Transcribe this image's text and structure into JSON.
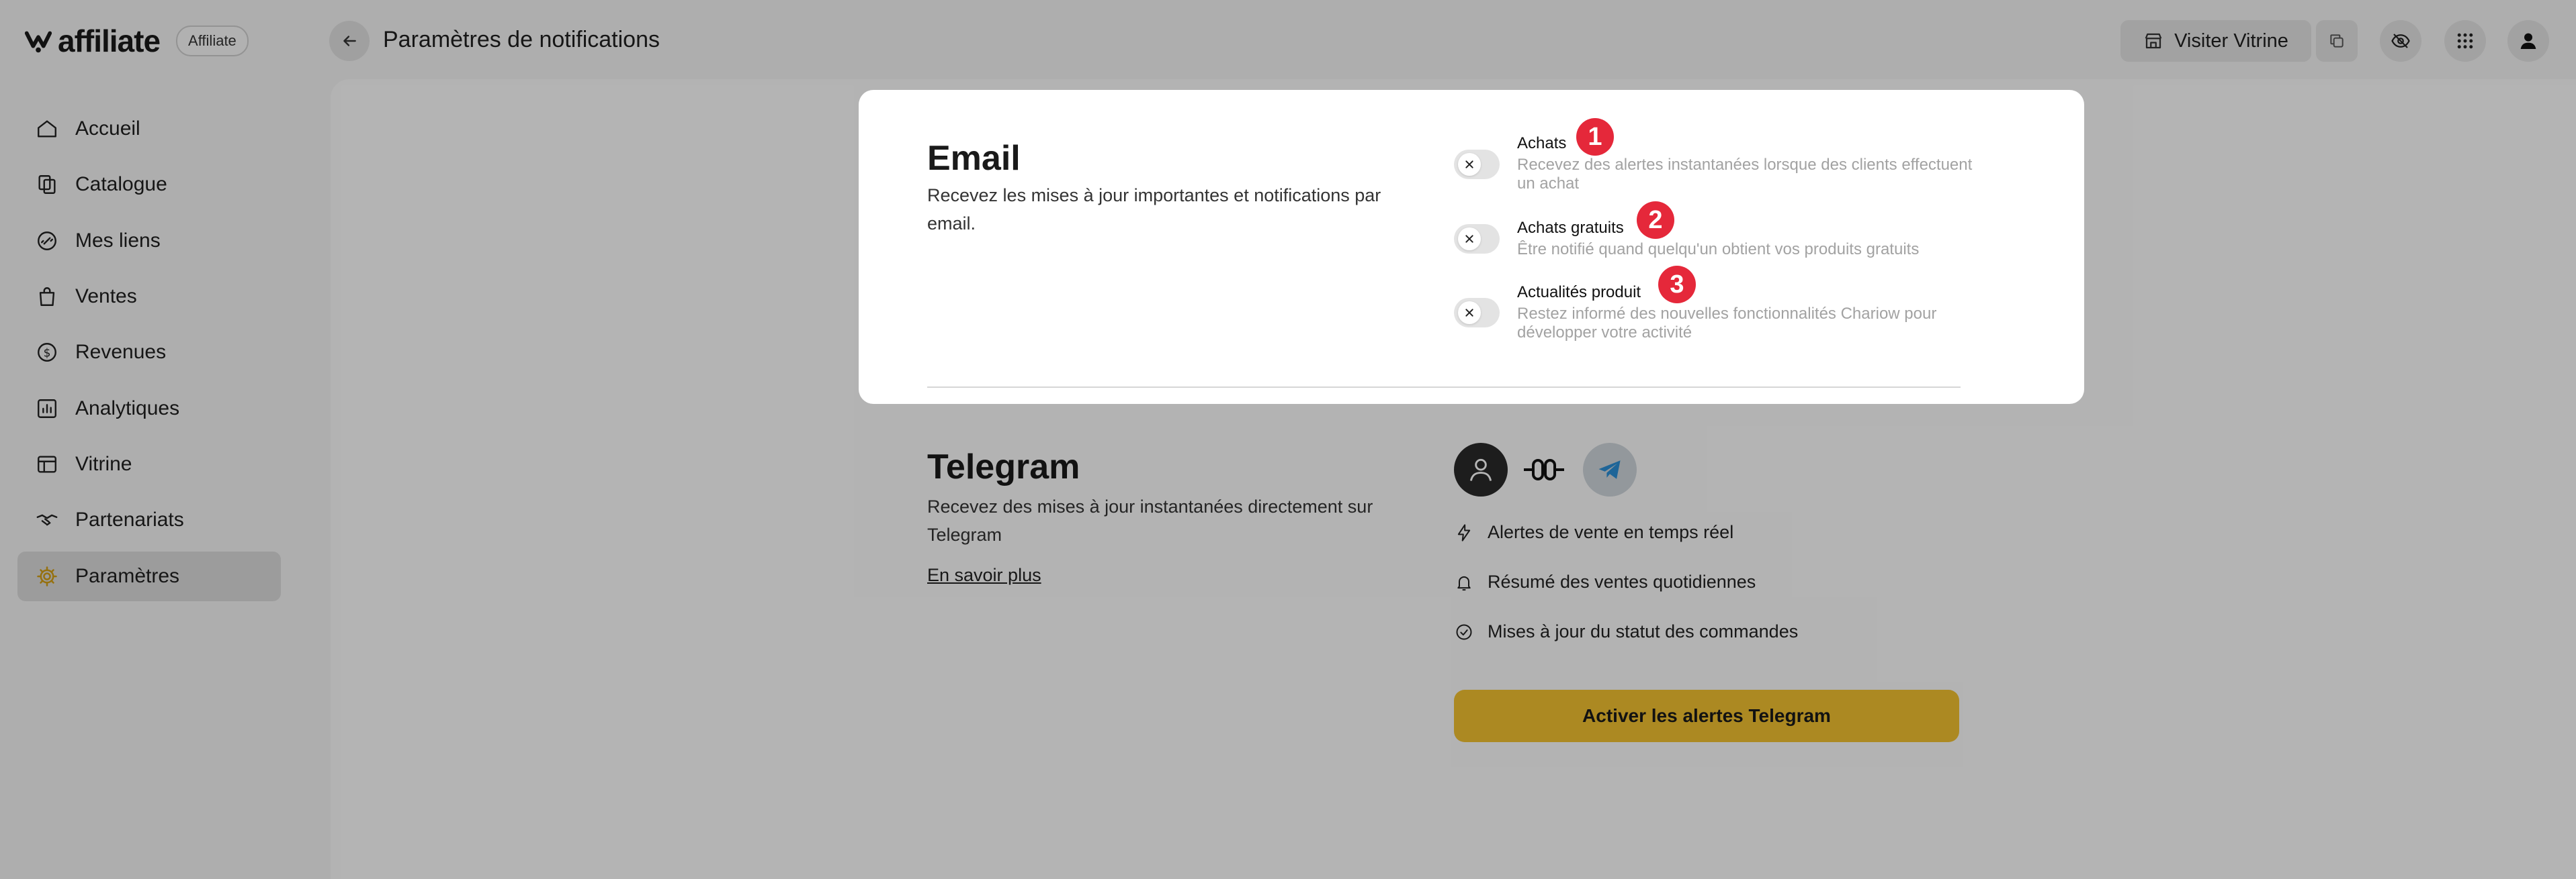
{
  "brand": {
    "name": "affiliate",
    "badge": "Affiliate"
  },
  "header": {
    "page_title": "Paramètres de notifications",
    "visit_label": "Visiter Vitrine"
  },
  "sidebar": {
    "items": [
      {
        "label": "Accueil",
        "icon": "home-icon"
      },
      {
        "label": "Catalogue",
        "icon": "catalog-icon"
      },
      {
        "label": "Mes liens",
        "icon": "link-icon"
      },
      {
        "label": "Ventes",
        "icon": "shopping-bag-icon"
      },
      {
        "label": "Revenues",
        "icon": "revenue-icon"
      },
      {
        "label": "Analytiques",
        "icon": "analytics-icon"
      },
      {
        "label": "Vitrine",
        "icon": "storefront-icon"
      },
      {
        "label": "Partenariats",
        "icon": "handshake-icon"
      },
      {
        "label": "Paramètres",
        "icon": "gear-icon",
        "active": true
      }
    ]
  },
  "email": {
    "title": "Email",
    "description": "Recevez les mises à jour importantes et notifications par email.",
    "options": [
      {
        "title": "Achats",
        "description": "Recevez des alertes instantanées lorsque des clients effectuent un achat",
        "enabled": false,
        "step": "1"
      },
      {
        "title": "Achats gratuits",
        "description": "Être notifié quand quelqu'un obtient vos produits gratuits",
        "enabled": false,
        "step": "2"
      },
      {
        "title": "Actualités produit",
        "description": "Restez informé des nouvelles fonctionnalités Chariow pour développer votre activité",
        "enabled": false,
        "step": "3"
      }
    ]
  },
  "telegram": {
    "title": "Telegram",
    "description": "Recevez des mises à jour instantanées directement sur Telegram",
    "learn_more": "En savoir plus",
    "features": [
      {
        "label": "Alertes de vente en temps réel",
        "icon": "lightning-icon"
      },
      {
        "label": "Résumé des ventes quotidiennes",
        "icon": "bell-icon"
      },
      {
        "label": "Mises à jour du statut des commandes",
        "icon": "check-circle-icon"
      }
    ],
    "button_label": "Activer les alertes Telegram"
  },
  "colors": {
    "accent": "#f2c230",
    "badge": "#e5283a",
    "overlay": "rgba(0,0,0,0.29)"
  }
}
